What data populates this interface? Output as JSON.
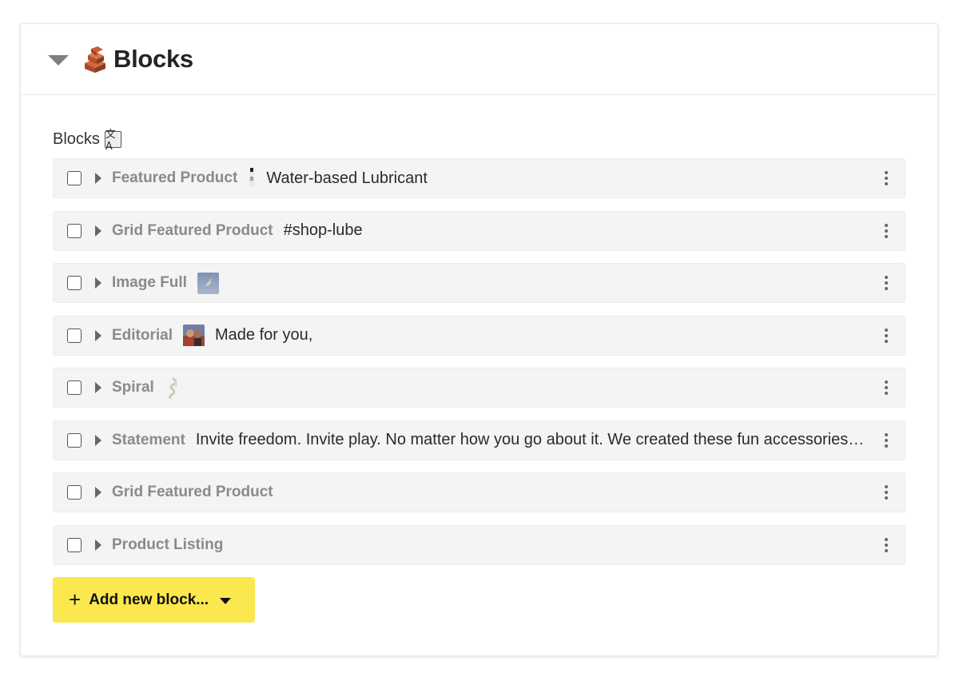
{
  "panel": {
    "title": "Blocks",
    "title_icon": "brick-emoji"
  },
  "field": {
    "label": "Blocks",
    "translate_icon": "translate-icon",
    "translate_glyph": "文A"
  },
  "blocks": [
    {
      "type": "Featured Product",
      "thumbnail": "bottle-thumbnail",
      "summary": "Water-based Lubricant"
    },
    {
      "type": "Grid Featured Product",
      "thumbnail": "",
      "summary": "#shop-lube"
    },
    {
      "type": "Image Full",
      "thumbnail": "photo-thumbnail",
      "summary": ""
    },
    {
      "type": "Editorial",
      "thumbnail": "people-thumbnail",
      "summary": "Made for you,"
    },
    {
      "type": "Spiral",
      "thumbnail": "spiral-thumbnail",
      "summary": ""
    },
    {
      "type": "Statement",
      "thumbnail": "",
      "summary": "Invite freedom. Invite play. No matter how you go about it. We created these fun accessories to help you explore with more pleasure."
    },
    {
      "type": "Grid Featured Product",
      "thumbnail": "",
      "summary": ""
    },
    {
      "type": "Product Listing",
      "thumbnail": "",
      "summary": ""
    }
  ],
  "add_button": {
    "plus": "+",
    "label": "Add new block..."
  },
  "colors": {
    "add_button_bg": "#fbe84f",
    "row_bg": "#f4f4f4",
    "type_label": "#8a8a8a"
  }
}
